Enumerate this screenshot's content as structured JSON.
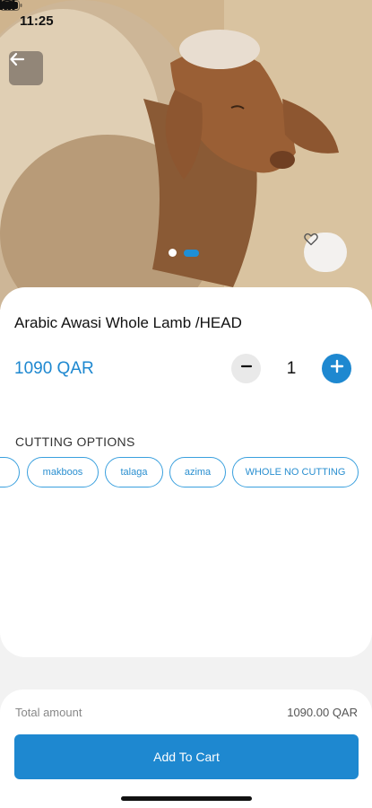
{
  "status_bar": {
    "time": "11:25"
  },
  "hero": {
    "active_slide": 2,
    "slide_count": 2
  },
  "product": {
    "title": "Arabic Awasi Whole Lamb /HEAD",
    "price": "1090 QAR",
    "quantity": "1"
  },
  "cutting": {
    "label": "CUTTING OPTIONS",
    "options": [
      "makboos",
      "talaga",
      "azima",
      "WHOLE NO CUTTING"
    ]
  },
  "footer": {
    "total_label": "Total amount",
    "total_value": "1090.00 QAR",
    "add_to_cart": "Add To Cart"
  },
  "colors": {
    "accent": "#1e88d0",
    "background": "#f2f2f2"
  },
  "icons": [
    "back-arrow-icon",
    "heart-icon",
    "minus-icon",
    "plus-icon",
    "signal-icon",
    "wifi-icon",
    "battery-icon",
    "bed-icon"
  ]
}
